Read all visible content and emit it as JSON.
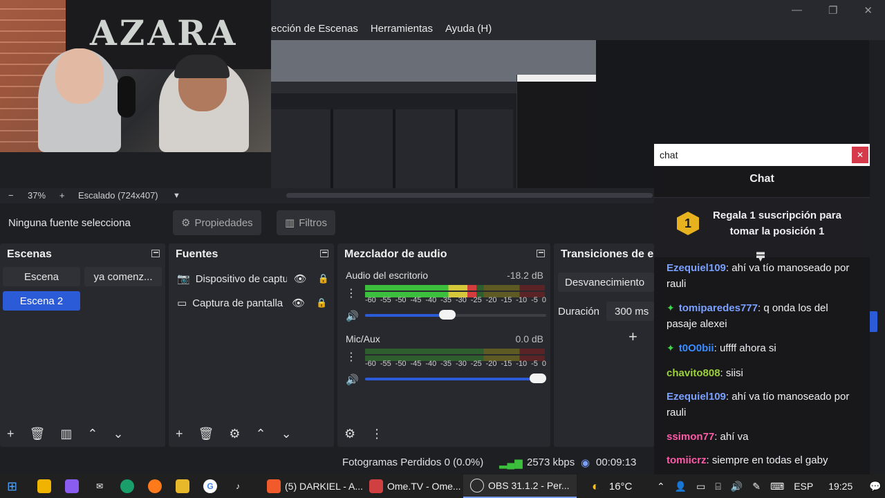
{
  "menu": {
    "items": [
      "ección de Escenas",
      "Herramientas",
      "Ayuda (H)"
    ],
    "window_buttons": [
      "—",
      "❐",
      "✕"
    ]
  },
  "webcam": {
    "shirt_text": "AZARA"
  },
  "zoom": {
    "minus": "−",
    "percent": "37%",
    "plus": "+",
    "scaling": "Escalado (724x407)",
    "caret": "▼"
  },
  "source_toolbar": {
    "no_selection": "Ninguna fuente selecciona",
    "properties": "Propiedades",
    "filters": "Filtros"
  },
  "scenes": {
    "title": "Escenas",
    "items": [
      "Escena",
      "ya comenz...",
      "Escena 2"
    ],
    "active_index": 2
  },
  "sources": {
    "title": "Fuentes",
    "items": [
      {
        "label": "Dispositivo de captura",
        "icon": "camera-icon"
      },
      {
        "label": "Captura de pantalla",
        "icon": "monitor-icon"
      }
    ]
  },
  "mixer": {
    "title": "Mezclador de audio",
    "ticks": [
      "-60",
      "-55",
      "-50",
      "-45",
      "-40",
      "-35",
      "-30",
      "-25",
      "-20",
      "-15",
      "-10",
      "-5",
      "0"
    ],
    "channels": [
      {
        "name": "Audio del escritorio",
        "db": "-18.2 dB",
        "level": 0.62,
        "volume": 0.5
      },
      {
        "name": "Mic/Aux",
        "db": "0.0 dB",
        "level": 0.0,
        "volume": 1.0
      }
    ]
  },
  "transitions": {
    "title": "Transiciones de es",
    "type": "Desvanecimiento",
    "duration_label": "Duración",
    "duration_value": "300 ms"
  },
  "chat": {
    "window_title": "chat",
    "close": "✕",
    "heading": "Chat",
    "promo_badge": "1",
    "promo_text": "Regala 1 suscripción para tomar la posición 1",
    "messages": [
      {
        "user": "Ezequiel109",
        "text": "ahí va tío manoseado por rauli",
        "color": "#7aa0ff",
        "badge": false
      },
      {
        "user": "tomiparedes777",
        "text": "q onda los del pasaje alexei",
        "color": "#7aa0ff",
        "badge": true
      },
      {
        "user": "t0O0bii",
        "text": "uffff ahora si",
        "color": "#3a8cff",
        "badge": true
      },
      {
        "user": "chavito808",
        "text": "siisi",
        "color": "#9cd13a",
        "badge": false
      },
      {
        "user": "Ezequiel109",
        "text": "ahí va tío manoseado por rauli",
        "color": "#7aa0ff",
        "badge": false
      },
      {
        "user": "ssimon77",
        "text": "ahí va",
        "color": "#ff5aa8",
        "badge": false
      },
      {
        "user": "tomiicrz",
        "text": "siempre en todas el gaby",
        "color": "#ff5aa8",
        "badge": false
      }
    ]
  },
  "status": {
    "dropped": "Fotogramas Perdidos 0 (0.0%)",
    "kbps": "2573 kbps",
    "time": "00:09:13"
  },
  "taskbar": {
    "tasks": [
      {
        "label": "(5) DARKIEL - A...",
        "icon": "brave-icon",
        "color": "#f15a2b"
      },
      {
        "label": "Ome.TV - Ome...",
        "icon": "mail-icon",
        "color": "#d04040"
      },
      {
        "label": "OBS 31.1.2 - Per...",
        "icon": "obs-icon",
        "color": "#e0e0e0"
      }
    ],
    "weather": "16°C",
    "language": "ESP",
    "clock": "19:25"
  }
}
